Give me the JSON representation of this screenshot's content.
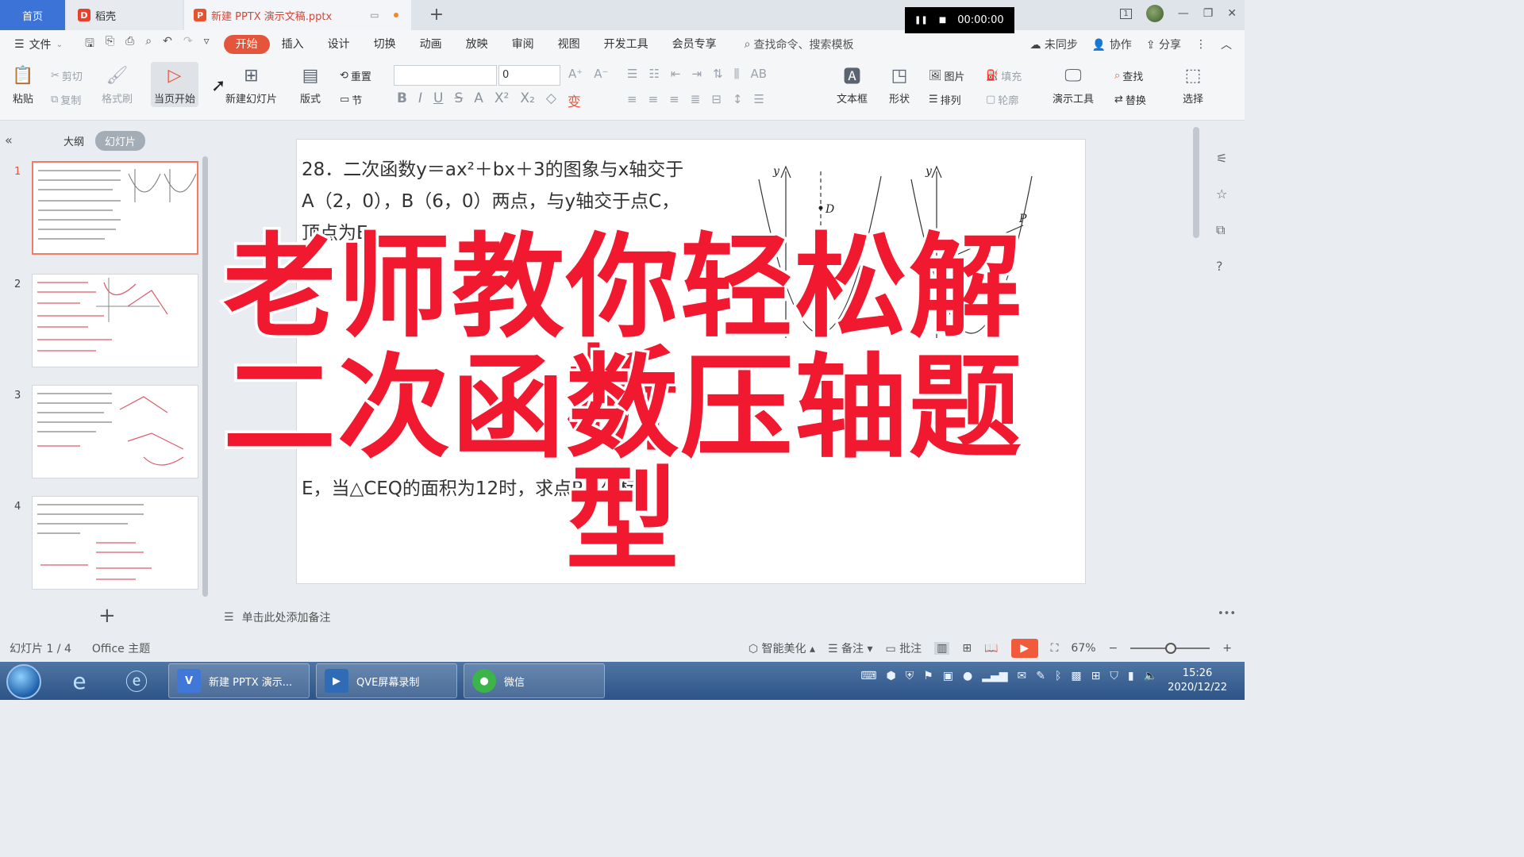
{
  "titlebar": {
    "tab_home": "首页",
    "tab_daoke": "稻壳",
    "tab_doc": "新建 PPTX 演示文稿.pptx",
    "recorder_time": "00:00:00",
    "badge": "1"
  },
  "menubar": {
    "file": "文件",
    "items": [
      "开始",
      "插入",
      "设计",
      "切换",
      "动画",
      "放映",
      "审阅",
      "视图",
      "开发工具",
      "会员专享"
    ],
    "search": "查找命令、搜索模板",
    "sync": "未同步",
    "collab": "协作",
    "share": "分享"
  },
  "ribbon": {
    "paste": "粘贴",
    "cut": "剪切",
    "copy": "复制",
    "format_painter": "格式刷",
    "start_from_current": "当页开始",
    "new_slide": "新建幻灯片",
    "layout": "版式",
    "reset": "重置",
    "section": "节",
    "font_size": "0",
    "textbox": "文本框",
    "shape": "形状",
    "picture": "图片",
    "fill": "填充",
    "arrange": "排列",
    "outline": "轮廓",
    "present_tools": "演示工具",
    "find": "查找",
    "replace": "替换",
    "select": "选择"
  },
  "leftpanel": {
    "tab_outline": "大纲",
    "tab_slides": "幻灯片",
    "slide_numbers": [
      "1",
      "2",
      "3",
      "4"
    ]
  },
  "slide": {
    "line1": "28．二次函数y＝ax²＋bx＋3的图象与x轴交于",
    "line2": "A（2，0），B（6，0）两点，与y轴交于点C，",
    "line3": "顶点为E．",
    "line_last": "E，当△CEQ的面积为12时，求点P的坐标．",
    "graph_labels": {
      "y": "y",
      "d": "D",
      "p": "P"
    }
  },
  "overlay": {
    "line1": "老师教你轻松解析",
    "line2": "二次函数压轴题型"
  },
  "notes": {
    "placeholder": "单击此处添加备注"
  },
  "statusbar": {
    "slide_counter": "幻灯片 1 / 4",
    "theme": "Office 主题",
    "beautify": "智能美化",
    "notes": "备注",
    "comments": "批注",
    "zoom": "67%"
  },
  "taskbar": {
    "apps": [
      "新建 PPTX 演示...",
      "QVE屏幕录制",
      "微信"
    ],
    "time": "15:26",
    "date": "2020/12/22"
  },
  "colors": {
    "accent": "#e3563b",
    "overlay_text": "#f0192f",
    "home_tab": "#3b74d6"
  }
}
